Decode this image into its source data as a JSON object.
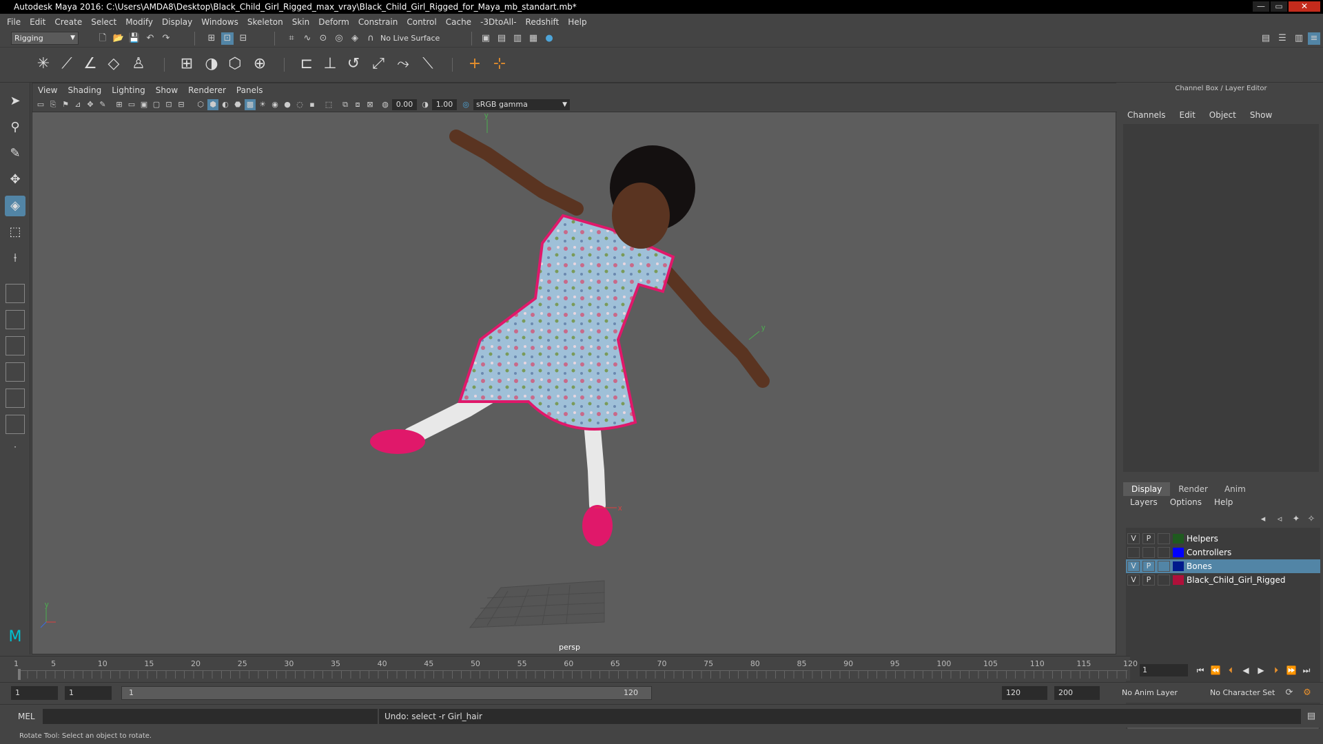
{
  "window": {
    "title": "Autodesk Maya 2016: C:\\Users\\AMDA8\\Desktop\\Black_Child_Girl_Rigged_max_vray\\Black_Child_Girl_Rigged_for_Maya_mb_standart.mb*",
    "min": "—",
    "max": "▭",
    "close": "✕"
  },
  "menubar": [
    "File",
    "Edit",
    "Create",
    "Select",
    "Modify",
    "Display",
    "Windows",
    "Skeleton",
    "Skin",
    "Deform",
    "Constrain",
    "Control",
    "Cache",
    "-3DtoAll-",
    "Redshift",
    "Help"
  ],
  "statusline": {
    "mode": "Rigging",
    "live_surface": "No Live Surface"
  },
  "viewport": {
    "menu": [
      "View",
      "Shading",
      "Lighting",
      "Show",
      "Renderer",
      "Panels"
    ],
    "exposure": "0.00",
    "gamma": "1.00",
    "color_space": "sRGB gamma",
    "camera": "persp"
  },
  "channel_box": {
    "title": "Channel Box / Layer Editor",
    "menu": [
      "Channels",
      "Edit",
      "Object",
      "Show"
    ]
  },
  "layer_editor": {
    "tabs": [
      "Display",
      "Render",
      "Anim"
    ],
    "active_tab": "Display",
    "menu": [
      "Layers",
      "Options",
      "Help"
    ],
    "layers": [
      {
        "v": "V",
        "p": "P",
        "name": "Helpers",
        "color": "#1f5a1f",
        "selected": false
      },
      {
        "v": "",
        "p": "",
        "name": "Controllers",
        "color": "#0000ff",
        "selected": false
      },
      {
        "v": "V",
        "p": "P",
        "name": "Bones",
        "color": "#001a8c",
        "selected": true
      },
      {
        "v": "V",
        "p": "P",
        "name": "Black_Child_Girl_Rigged",
        "color": "#b0103a",
        "selected": false
      }
    ]
  },
  "timeline": {
    "ticks": [
      "1",
      "5",
      "10",
      "15",
      "20",
      "25",
      "30",
      "35",
      "40",
      "45",
      "50",
      "55",
      "60",
      "65",
      "70",
      "75",
      "80",
      "85",
      "90",
      "95",
      "100",
      "105",
      "110",
      "115",
      "120"
    ],
    "current_frame": "1"
  },
  "range": {
    "start": "1",
    "playback_start": "1",
    "slider_start": "1",
    "slider_end": "120",
    "playback_end": "120",
    "end": "200",
    "anim_layer": "No Anim Layer",
    "character_set": "No Character Set"
  },
  "command": {
    "lang": "MEL",
    "result": "Undo: select -r Girl_hair"
  },
  "help_line": "Rotate Tool: Select an object to rotate.",
  "colors": {
    "accent": "#5285a6",
    "bg": "#444444",
    "viewport": "#5d5d5d"
  }
}
